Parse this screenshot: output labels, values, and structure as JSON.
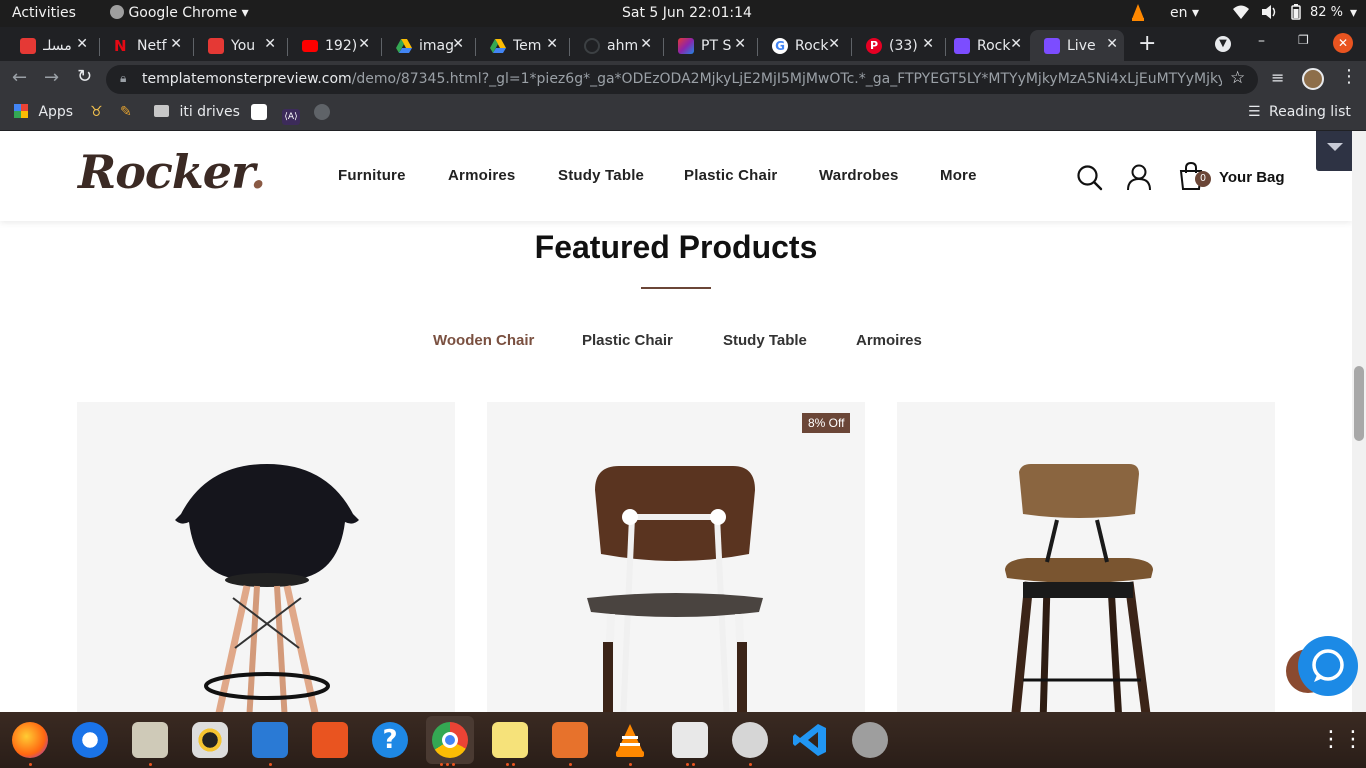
{
  "system_bar": {
    "activities": "Activities",
    "app_name": "Google Chrome",
    "clock": "Sat 5 Jun  22:01:14",
    "language": "en",
    "battery": "82 %"
  },
  "tabs": [
    {
      "label": "مسلـ",
      "color": "#e53935"
    },
    {
      "label": "Netf",
      "color": "#e50914"
    },
    {
      "label": "You",
      "color": "#e53935"
    },
    {
      "label": "192)",
      "color": "#ff0000"
    },
    {
      "label": "imag",
      "color": "#1e88e5"
    },
    {
      "label": "Tem",
      "color": "#43a047"
    },
    {
      "label": "ahm",
      "color": "#202124"
    },
    {
      "label": "PT S",
      "color": "#8e24aa"
    },
    {
      "label": "Rock",
      "color": "#ffffff"
    },
    {
      "label": "(33)",
      "color": "#e60023"
    },
    {
      "label": "Rock",
      "color": "#7c4dff"
    },
    {
      "label": "Live",
      "color": "#7c4dff"
    }
  ],
  "browser": {
    "url_host": "templatemonsterpreview.com",
    "url_path": "/demo/87345.html?_gl=1*piez6g*_ga*ODEzODA2MjkyLjE2MjI5MjMwOTc.*_ga_FTPYEGT5LY*MTYyMjkyMzA5Ni4xLjEuMTYyMjkyMzIwMy...",
    "new_tab": "+",
    "tab_close": "✕"
  },
  "bookmarks": {
    "apps": "Apps",
    "iti_drives": "iti drives",
    "reading_list": "Reading list"
  },
  "site": {
    "logo_text": "Rocker",
    "logo_dot": ".",
    "nav": [
      "Furniture",
      "Armoires",
      "Study Table",
      "Plastic Chair",
      "Wardrobes",
      "More"
    ],
    "bag_count": "0",
    "bag_label": "Your Bag",
    "featured_title": "Featured Products",
    "product_tabs": [
      "Wooden Chair",
      "Plastic Chair",
      "Study Table",
      "Armoires"
    ],
    "sale_badge": "8% Off",
    "accent": "#6b4637"
  }
}
